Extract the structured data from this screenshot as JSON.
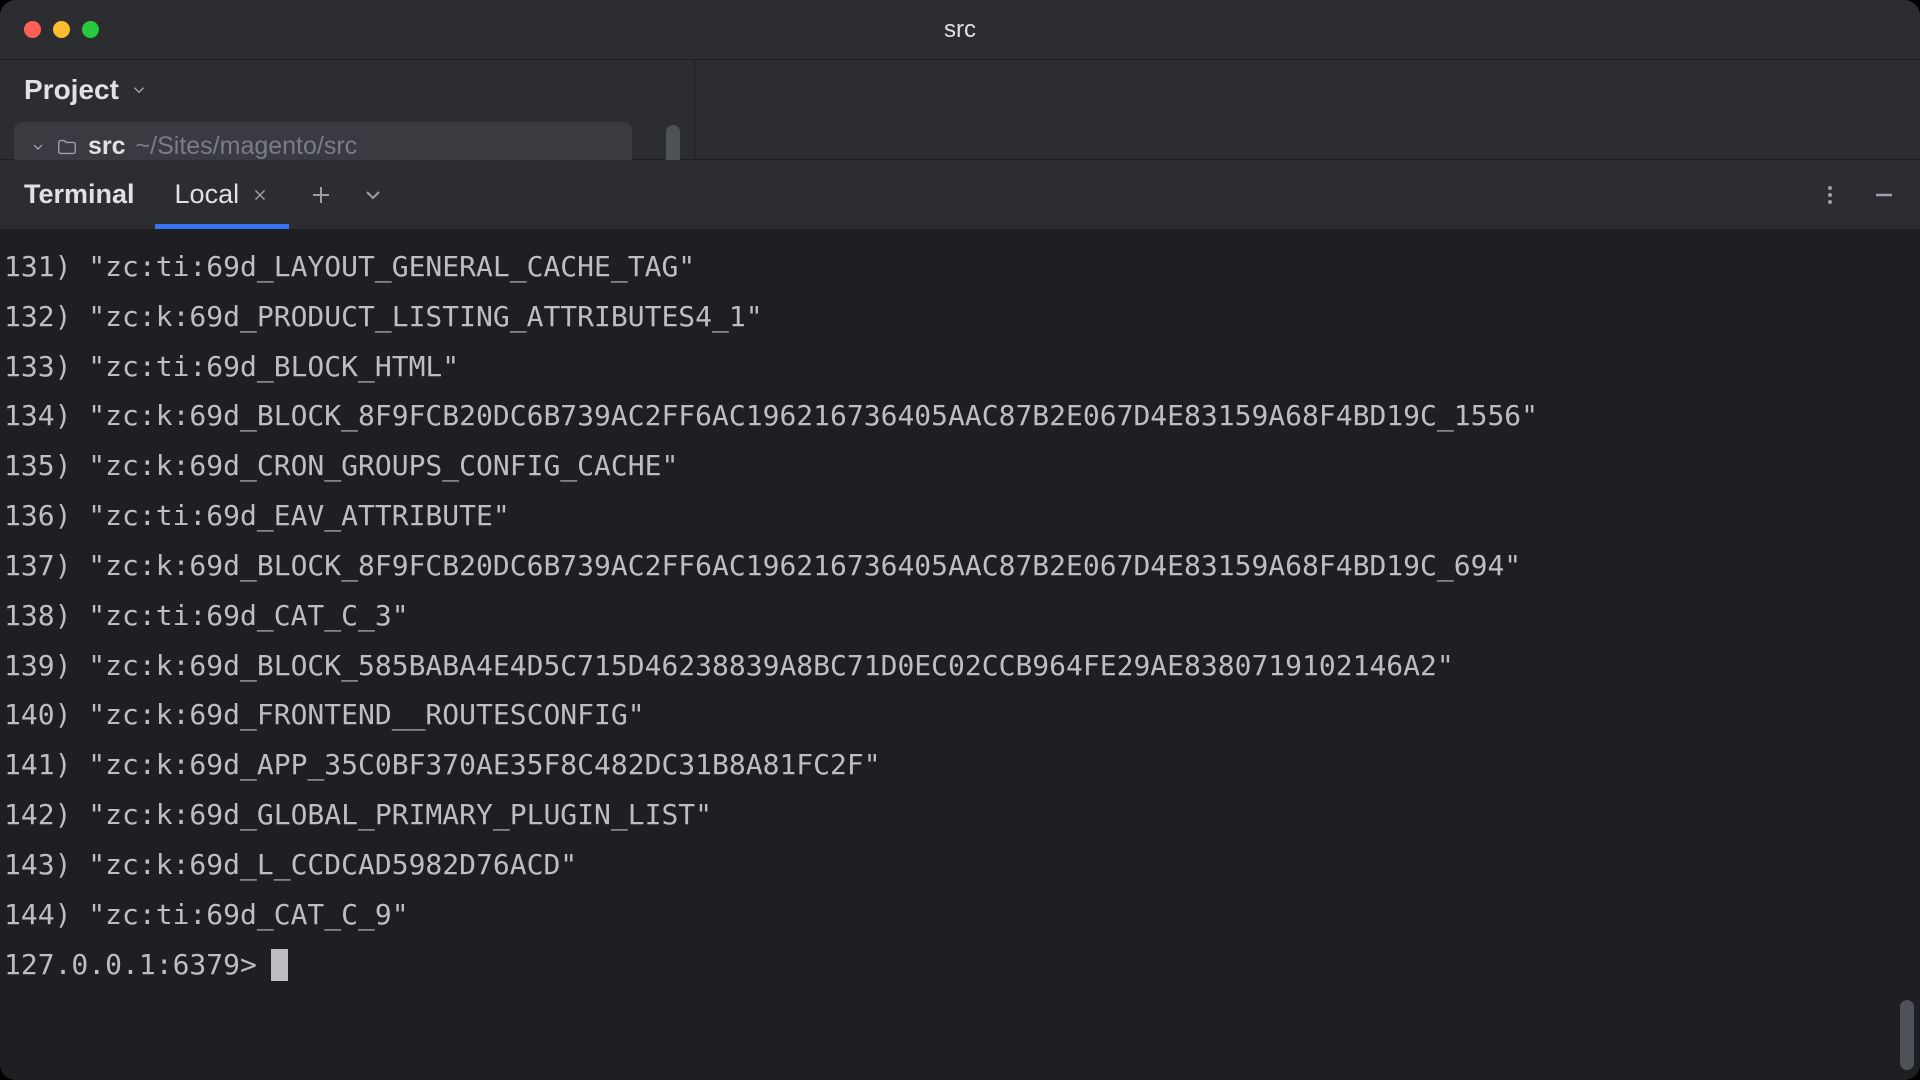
{
  "window": {
    "title": "src"
  },
  "project": {
    "label": "Project",
    "folder_name": "src",
    "folder_path": "~/Sites/magento/src"
  },
  "terminal": {
    "panel_label": "Terminal",
    "tab_label": "Local",
    "prompt": "127.0.0.1:6379>",
    "lines": [
      {
        "num": "131)",
        "text": "\"zc:ti:69d_LAYOUT_GENERAL_CACHE_TAG\""
      },
      {
        "num": "132)",
        "text": "\"zc:k:69d_PRODUCT_LISTING_ATTRIBUTES4_1\""
      },
      {
        "num": "133)",
        "text": "\"zc:ti:69d_BLOCK_HTML\""
      },
      {
        "num": "134)",
        "text": "\"zc:k:69d_BLOCK_8F9FCB20DC6B739AC2FF6AC196216736405AAC87B2E067D4E83159A68F4BD19C_1556\""
      },
      {
        "num": "135)",
        "text": "\"zc:k:69d_CRON_GROUPS_CONFIG_CACHE\""
      },
      {
        "num": "136)",
        "text": "\"zc:ti:69d_EAV_ATTRIBUTE\""
      },
      {
        "num": "137)",
        "text": "\"zc:k:69d_BLOCK_8F9FCB20DC6B739AC2FF6AC196216736405AAC87B2E067D4E83159A68F4BD19C_694\""
      },
      {
        "num": "138)",
        "text": "\"zc:ti:69d_CAT_C_3\""
      },
      {
        "num": "139)",
        "text": "\"zc:k:69d_BLOCK_585BABA4E4D5C715D46238839A8BC71D0EC02CCB964FE29AE8380719102146A2\""
      },
      {
        "num": "140)",
        "text": "\"zc:k:69d_FRONTEND__ROUTESCONFIG\""
      },
      {
        "num": "141)",
        "text": "\"zc:k:69d_APP_35C0BF370AE35F8C482DC31B8A81FC2F\""
      },
      {
        "num": "142)",
        "text": "\"zc:k:69d_GLOBAL_PRIMARY_PLUGIN_LIST\""
      },
      {
        "num": "143)",
        "text": "\"zc:k:69d_L_CCDCAD5982D76ACD\""
      },
      {
        "num": "144)",
        "text": "\"zc:ti:69d_CAT_C_9\""
      }
    ]
  }
}
